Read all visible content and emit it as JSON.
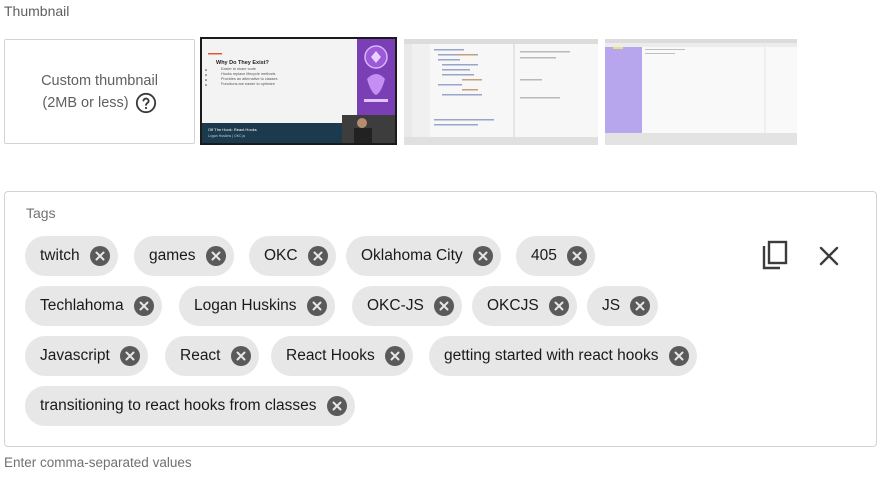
{
  "thumbnail": {
    "section_label": "Thumbnail",
    "custom": {
      "line1": "Custom thumbnail",
      "line2": "(2MB or less)",
      "help_icon": "help-circle-icon"
    },
    "options": [
      {
        "selected": true,
        "slide_title": "Why Do They Exist?",
        "bullets": [
          "Easier to share code",
          "Hooks replace lifecycle methods",
          "Provides an alternative to classes",
          "Functions are easier to optimize"
        ],
        "caption_title": "Off The Hook: React Hooks",
        "caption_sub": "Logan Huskins | OKC.js"
      },
      {
        "selected": false
      },
      {
        "selected": false
      }
    ]
  },
  "tags": {
    "label": "Tags",
    "items": [
      "twitch",
      "games",
      "OKC",
      "Oklahoma City",
      "405",
      "Techlahoma",
      "Logan Huskins",
      "OKC-JS",
      "OKCJS",
      "JS",
      "Javascript",
      "React",
      "React Hooks",
      "getting started with react hooks",
      "transitioning to react hooks from classes"
    ],
    "remove_icon": "cancel-circle-icon",
    "actions": {
      "copy_icon": "copy-icon",
      "clear_icon": "close-icon"
    }
  },
  "helper_text": "Enter comma-separated values"
}
